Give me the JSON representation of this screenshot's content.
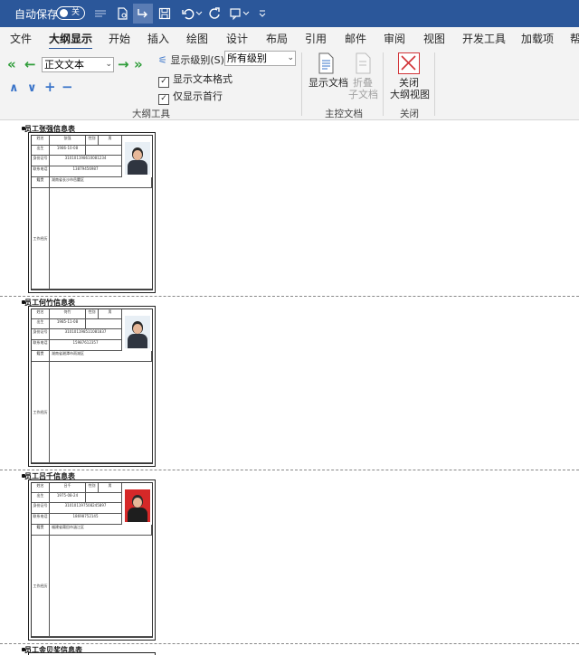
{
  "titlebar": {
    "autosave_label": "自动保存",
    "autosave_state": "关"
  },
  "tabs": [
    {
      "label": "文件"
    },
    {
      "label": "大纲显示"
    },
    {
      "label": "开始"
    },
    {
      "label": "插入"
    },
    {
      "label": "绘图"
    },
    {
      "label": "设计"
    },
    {
      "label": "布局"
    },
    {
      "label": "引用"
    },
    {
      "label": "邮件"
    },
    {
      "label": "审阅"
    },
    {
      "label": "视图"
    },
    {
      "label": "开发工具"
    },
    {
      "label": "加载项"
    },
    {
      "label": "帮"
    }
  ],
  "outline_tools": {
    "level_combo_value": "正文文本",
    "show_level_label": "显示级别(S):",
    "show_level_value": "所有级别",
    "show_text_format_label": "显示文本格式",
    "show_text_format_checked": true,
    "show_first_line_label": "仅显示首行",
    "show_first_line_checked": true,
    "group_label": "大纲工具"
  },
  "master_doc": {
    "show_doc_label": "显示文档",
    "collapse_line1": "折叠",
    "collapse_line2": "子文档",
    "group_label": "主控文档"
  },
  "close_group": {
    "close_line1": "关闭",
    "close_line2": "大纲视图",
    "group_label": "关闭"
  },
  "document": {
    "sections": [
      {
        "title": "员工张强信息表",
        "labels": {
          "name": "姓名",
          "gender": "性别",
          "birth": "出生",
          "id": "身份证号",
          "phone": "联系电话",
          "hometown": "籍贯",
          "resume": "工作经历"
        },
        "values": {
          "name": "张强",
          "gender": "男",
          "birth": "1986-10-08",
          "id": "310101198610081234",
          "phone": "13879456987",
          "hometown": "湖南省长沙市岳麓区"
        }
      },
      {
        "title": "员工何竹信息表",
        "labels": {
          "name": "姓名",
          "gender": "性别",
          "birth": "出生",
          "id": "身份证号",
          "phone": "联系电话",
          "hometown": "籍贯",
          "resume": "工作经历"
        },
        "values": {
          "name": "何竹",
          "gender": "男",
          "birth": "1985-11-08",
          "id": "310101198511081837",
          "phone": "15987612357",
          "hometown": "湖南省湘潭市雨湖区"
        }
      },
      {
        "title": "员工吕千信息表",
        "labels": {
          "name": "姓名",
          "gender": "性别",
          "birth": "出生",
          "id": "身份证号",
          "phone": "联系电话",
          "hometown": "籍贯",
          "resume": "工作经历"
        },
        "values": {
          "name": "吕千",
          "gender": "男",
          "birth": "1975-08-24",
          "id": "310101197508245897",
          "phone": "18698752145",
          "hometown": "福建省莆田市涵江区"
        }
      },
      {
        "title": "员工金贝奖信息表"
      }
    ]
  }
}
